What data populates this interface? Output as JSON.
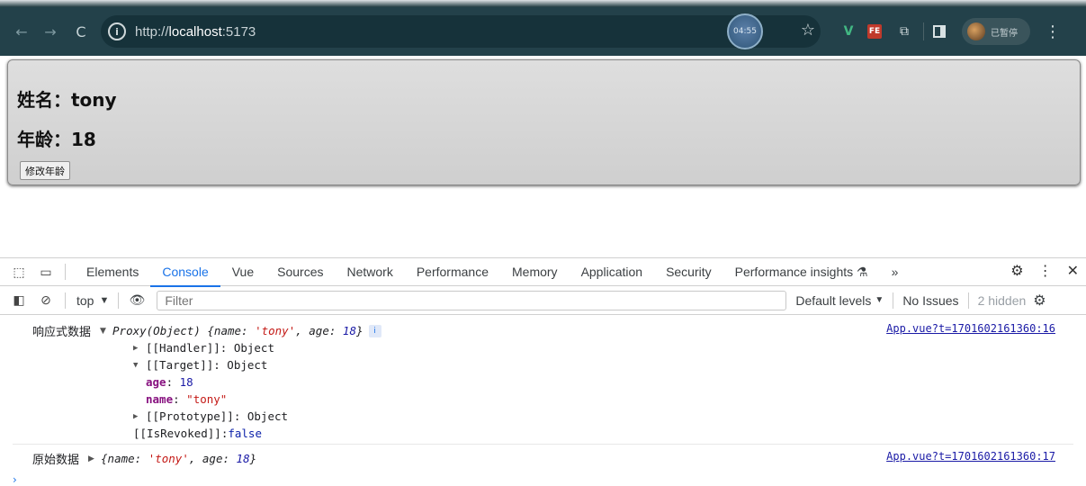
{
  "browser": {
    "url_prefix": "http://",
    "url_host": "localhost",
    "url_port": ":5173",
    "timer": "04:55",
    "profile_label": "已暂停",
    "extensions": {
      "v": "V",
      "fe": "FE"
    }
  },
  "page": {
    "name_line": "姓名：tony",
    "age_line": "年龄：18",
    "button_label": "修改年龄"
  },
  "devtools": {
    "tabs": [
      "Elements",
      "Console",
      "Vue",
      "Sources",
      "Network",
      "Performance",
      "Memory",
      "Application",
      "Security",
      "Performance insights"
    ],
    "active_tab": "Console",
    "more": "»"
  },
  "console_bar": {
    "context": "top",
    "filter_placeholder": "Filter",
    "levels": "Default levels",
    "issues": "No Issues",
    "hidden": "2 hidden"
  },
  "logs": {
    "reactive": {
      "label": "响应式数据",
      "proxy": "Proxy(Object)",
      "preview_open": "{name: ",
      "preview_name": "'tony'",
      "preview_mid": ", age: ",
      "preview_age": "18",
      "preview_close": "}",
      "handler": "[[Handler]]: Object",
      "target": "[[Target]]: Object",
      "age_key": "age",
      "age_value": "18",
      "name_key": "name",
      "name_value": "\"tony\"",
      "prototype": "[[Prototype]]: Object",
      "revoked_key": "[[IsRevoked]]: ",
      "revoked_value": "false",
      "source": "App.vue?t=1701602161360:16"
    },
    "raw": {
      "label": "原始数据",
      "preview_open": "{name: ",
      "preview_name": "'tony'",
      "preview_mid": ", age: ",
      "preview_age": "18",
      "preview_close": "}",
      "source": "App.vue?t=1701602161360:17"
    }
  }
}
